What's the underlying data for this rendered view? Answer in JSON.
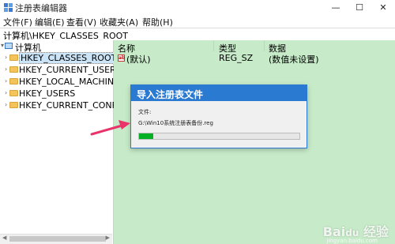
{
  "window": {
    "title": "注册表编辑器",
    "controls": {
      "minimize": "—",
      "maximize": "☐",
      "close": "✕"
    }
  },
  "menu": [
    "文件(F)",
    "编辑(E)",
    "查看(V)",
    "收藏夹(A)",
    "帮助(H)"
  ],
  "address": "计算机\\HKEY_CLASSES_ROOT",
  "tree": {
    "root": "计算机",
    "items": [
      "HKEY_CLASSES_ROOT",
      "HKEY_CURRENT_USER",
      "HKEY_LOCAL_MACHINE",
      "HKEY_USERS",
      "HKEY_CURRENT_CONFIG"
    ],
    "selected": "HKEY_CLASSES_ROOT"
  },
  "list": {
    "headers": {
      "name": "名称",
      "type": "类型",
      "data": "数据"
    },
    "rows": [
      {
        "name": "(默认)",
        "type": "REG_SZ",
        "data": "(数值未设置)"
      }
    ]
  },
  "dialog": {
    "title": "导入注册表文件",
    "label": "文件:",
    "path": "G:\\Win10系统注册表备份.reg",
    "progress": 0.09
  },
  "colors": {
    "dialog_title": "#2b7ad2",
    "progress": "#06b025",
    "right_pane_bg": "#c7ebc9",
    "annotation_arrow": "#e8336b"
  },
  "watermark": {
    "logo": "Bai du 经验",
    "url": "jingyan.baidu.com"
  }
}
